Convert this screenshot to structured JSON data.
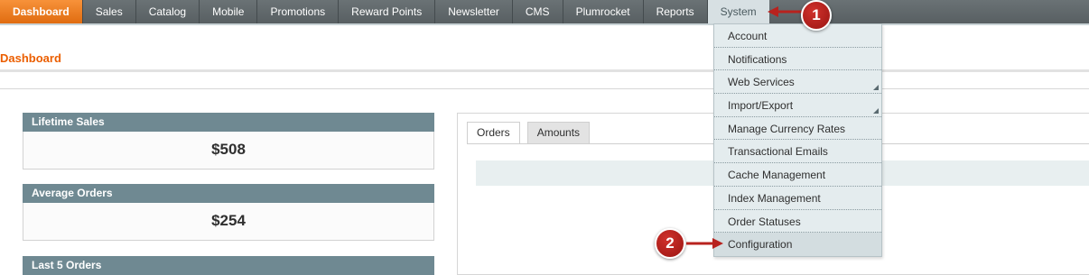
{
  "nav": {
    "items": [
      {
        "label": "Dashboard"
      },
      {
        "label": "Sales"
      },
      {
        "label": "Catalog"
      },
      {
        "label": "Mobile"
      },
      {
        "label": "Promotions"
      },
      {
        "label": "Reward Points"
      },
      {
        "label": "Newsletter"
      },
      {
        "label": "CMS"
      },
      {
        "label": "Plumrocket"
      },
      {
        "label": "Reports"
      },
      {
        "label": "System"
      }
    ],
    "active_index": 0,
    "open_index": 10
  },
  "page": {
    "title": "Dashboard"
  },
  "stats": {
    "lifetime_sales": {
      "label": "Lifetime Sales",
      "value": "$508"
    },
    "average_orders": {
      "label": "Average Orders",
      "value": "$254"
    },
    "last5": {
      "label": "Last 5 Orders"
    }
  },
  "panel": {
    "tabs": [
      {
        "label": "Orders"
      },
      {
        "label": "Amounts"
      }
    ],
    "active_tab": 0
  },
  "system_menu": {
    "items": [
      {
        "label": "Account",
        "has_submenu": false
      },
      {
        "label": "Notifications",
        "has_submenu": false
      },
      {
        "label": "Web Services",
        "has_submenu": true
      },
      {
        "label": "Import/Export",
        "has_submenu": true
      },
      {
        "label": "Manage Currency Rates",
        "has_submenu": false
      },
      {
        "label": "Transactional Emails",
        "has_submenu": false
      },
      {
        "label": "Cache Management",
        "has_submenu": false
      },
      {
        "label": "Index Management",
        "has_submenu": false
      },
      {
        "label": "Order Statuses",
        "has_submenu": false
      },
      {
        "label": "Configuration",
        "has_submenu": false
      }
    ]
  },
  "callouts": {
    "one": "1",
    "two": "2"
  },
  "colors": {
    "nav_bg": "#5f6669",
    "active_orange": "#eb6a10",
    "title_orange": "#eb5e00",
    "stat_header": "#6f8992",
    "menu_bg": "#e4ecee",
    "callout_red": "#b8221e"
  }
}
